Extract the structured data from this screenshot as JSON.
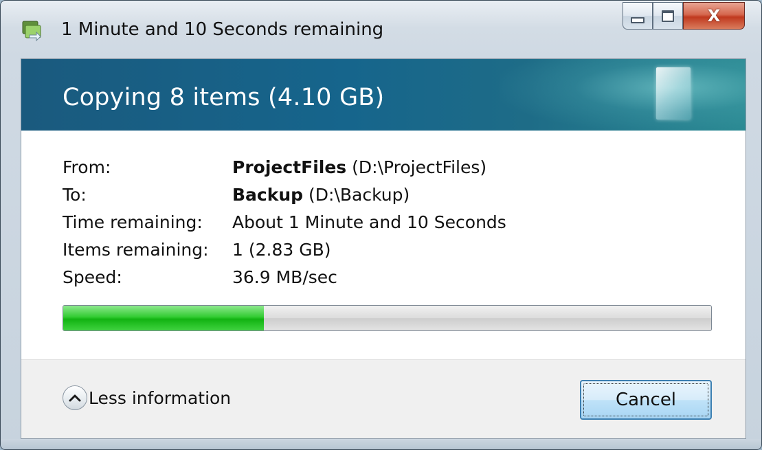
{
  "window": {
    "title": "1 Minute and 10 Seconds remaining",
    "controls": {
      "minimize_icon": "minimize-icon",
      "maximize_icon": "maximize-icon",
      "close_glyph": "X"
    }
  },
  "header": {
    "title": "Copying 8 items (4.10 GB)"
  },
  "details": {
    "from_label": "From:",
    "from_name": "ProjectFiles",
    "from_path": "(D:\\ProjectFiles)",
    "to_label": "To:",
    "to_name": "Backup",
    "to_path": "(D:\\Backup)",
    "time_label": "Time remaining:",
    "time_value": "About 1 Minute and 10 Seconds",
    "items_label": "Items remaining:",
    "items_value": "1 (2.83 GB)",
    "speed_label": "Speed:",
    "speed_value": "36.9 MB/sec"
  },
  "progress": {
    "fraction": 0.31,
    "fill_color": "#22c022"
  },
  "footer": {
    "less_info_label": "Less information",
    "cancel_label": "Cancel"
  },
  "colors": {
    "header_band": "#16658c",
    "cancel_border": "#3c7fb1"
  }
}
